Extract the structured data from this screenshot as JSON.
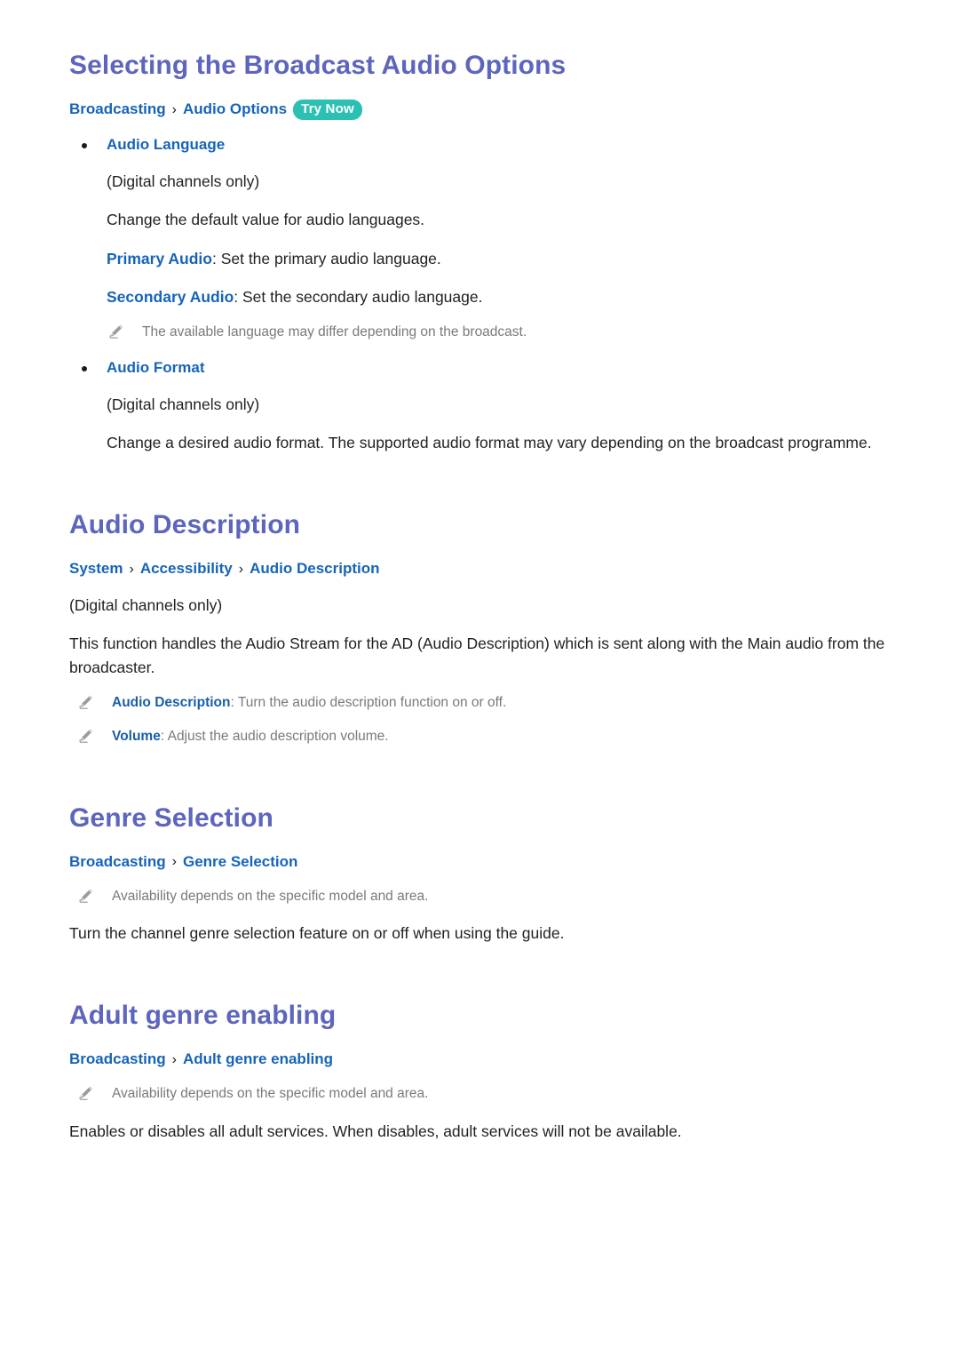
{
  "document": {
    "sections": [
      {
        "id": "broadcast-audio-options",
        "title": "Selecting the Broadcast Audio Options",
        "breadcrumb": {
          "crumbs": [
            "Broadcasting",
            "Audio Options"
          ],
          "separator": "›",
          "badge": "Try Now"
        },
        "bullets": [
          {
            "label": "Audio Language",
            "note_line": "(Digital channels only)",
            "paragraph": "Change the default value for audio languages.",
            "options": [
              {
                "label": "Primary Audio",
                "text": ": Set the primary audio language."
              },
              {
                "label": "Secondary Audio",
                "text": ": Set the secondary audio language."
              }
            ],
            "note": "The available language may differ depending on the broadcast."
          },
          {
            "label": "Audio Format",
            "note_line": "(Digital channels only)",
            "paragraph": "Change a desired audio format. The supported audio format may vary depending on the broadcast programme."
          }
        ]
      },
      {
        "id": "audio-description",
        "title": "Audio Description",
        "breadcrumb": {
          "crumbs": [
            "System",
            "Accessibility",
            "Audio Description"
          ],
          "separator": "›"
        },
        "note_line": "(Digital channels only)",
        "paragraph": "This function handles the Audio Stream for the AD (Audio Description) which is sent along with the Main audio from the broadcaster.",
        "notes": [
          {
            "label": "Audio Description",
            "text": ": Turn the audio description function on or off."
          },
          {
            "label": "Volume",
            "text": ": Adjust the audio description volume."
          }
        ]
      },
      {
        "id": "genre-selection",
        "title": "Genre Selection",
        "breadcrumb": {
          "crumbs": [
            "Broadcasting",
            "Genre Selection"
          ],
          "separator": "›"
        },
        "note": "Availability depends on the specific model and area.",
        "paragraph": "Turn the channel genre selection feature on or off when using the guide."
      },
      {
        "id": "adult-genre-enabling",
        "title": "Adult genre enabling",
        "breadcrumb": {
          "crumbs": [
            "Broadcasting",
            "Adult genre enabling"
          ],
          "separator": "›"
        },
        "note": "Availability depends on the specific model and area.",
        "paragraph": "Enables or disables all adult services. When disables, adult services will not be available."
      }
    ]
  },
  "icons": {
    "note_icon": "pencil-icon"
  },
  "colors": {
    "heading": "#5d65bd",
    "link": "#1664ba",
    "badge_bg": "#2cc0b3",
    "body_text": "#231f20",
    "note_text": "#7a7a7a"
  }
}
